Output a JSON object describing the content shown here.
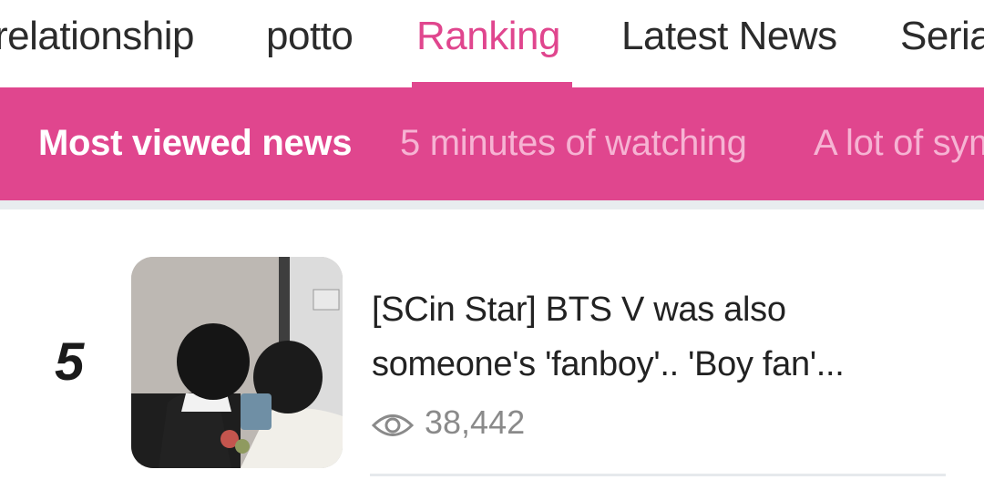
{
  "top_nav": {
    "tabs": [
      {
        "label": "relationship",
        "active": false
      },
      {
        "label": "potto",
        "active": false
      },
      {
        "label": "Ranking",
        "active": true
      },
      {
        "label": "Latest News",
        "active": false
      },
      {
        "label": "Serial",
        "active": false
      }
    ]
  },
  "sub_nav": {
    "tabs": [
      {
        "label": "Most viewed news",
        "active": true
      },
      {
        "label": "5 minutes of watching",
        "active": false
      },
      {
        "label": "A lot of sympathy",
        "active": false
      }
    ]
  },
  "news": [
    {
      "rank": "5",
      "headline": "[SCin Star] BTS V was also someone's 'fanboy'.. 'Boy fan'...",
      "views": "38,442",
      "view_icon": "eye-icon"
    }
  ],
  "colors": {
    "accent": "#e0468e",
    "sub_tab_inactive": "#f6b3d3",
    "text_dark": "#222222",
    "text_muted": "#8a8a8a"
  }
}
